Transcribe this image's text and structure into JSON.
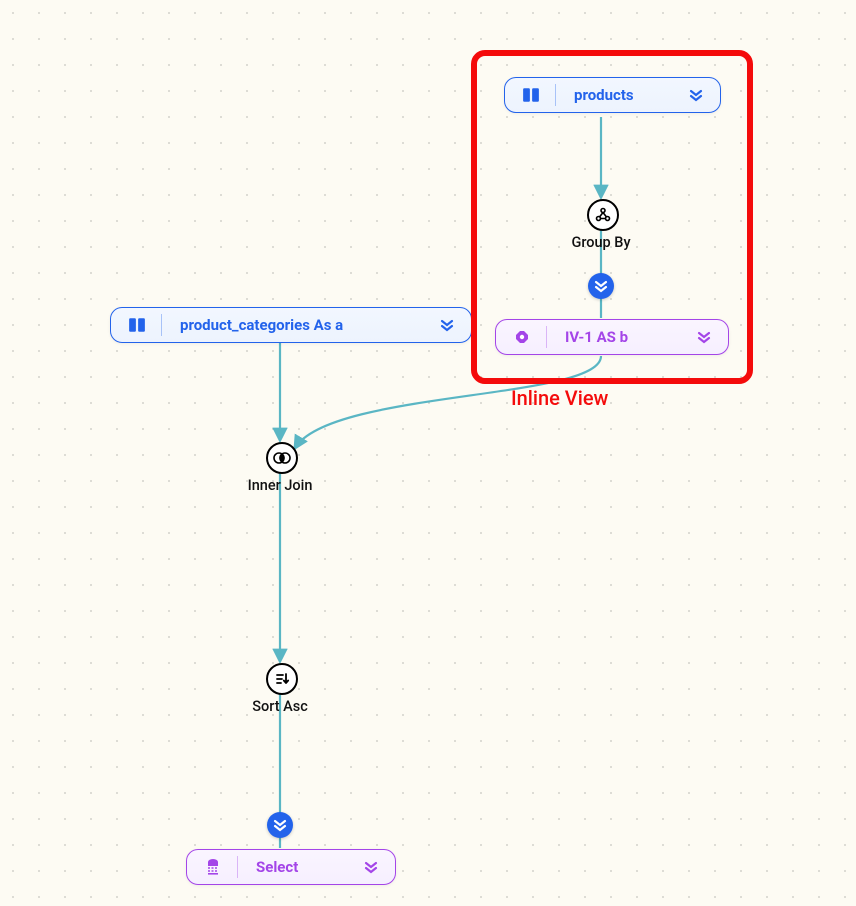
{
  "nodes": {
    "products": {
      "label": "products"
    },
    "product_categories": {
      "label": "product_categories As a"
    },
    "iv1": {
      "label": "IV-1 AS b"
    },
    "select": {
      "label": "Select"
    }
  },
  "ops": {
    "groupby": {
      "label": "Group By"
    },
    "innerjoin": {
      "label": "Inner Join"
    },
    "sortasc": {
      "label": "Sort Asc"
    }
  },
  "annotation": {
    "inline_view": "Inline View"
  }
}
